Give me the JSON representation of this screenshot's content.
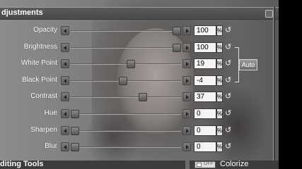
{
  "panel": {
    "title": "djustments"
  },
  "rows": [
    {
      "label": "Opacity",
      "value": "100",
      "unit": "%",
      "position": 1.0
    },
    {
      "label": "Brightness",
      "value": "100",
      "unit": "%",
      "position": 1.0
    },
    {
      "label": "White Point",
      "value": "19",
      "unit": "%",
      "position": 0.55
    },
    {
      "label": "Black Point",
      "value": "-4",
      "unit": "%",
      "position": 0.47
    },
    {
      "label": "Contrast",
      "value": "37",
      "unit": "%",
      "position": 0.67
    },
    {
      "label": "Hue",
      "value": "0",
      "unit": "%",
      "position": 0.0
    },
    {
      "label": "Sharpen",
      "value": "0",
      "unit": "%",
      "position": 0.0
    },
    {
      "label": "Blur",
      "value": "0",
      "unit": "%",
      "position": 0.0
    }
  ],
  "auto_button": {
    "label": "Auto"
  },
  "footer": {
    "title": "diting Tools",
    "toggle_label": "OFF",
    "colorize_label": "Colorize"
  },
  "icons": {
    "decrement": "arrow-left-icon",
    "increment": "arrow-right-icon",
    "reset": "reset-icon"
  },
  "colors": {
    "panel_bg": "#7a7a7a",
    "header_bg": "#4f4f4f",
    "field_bg": "#f4f4f4"
  }
}
